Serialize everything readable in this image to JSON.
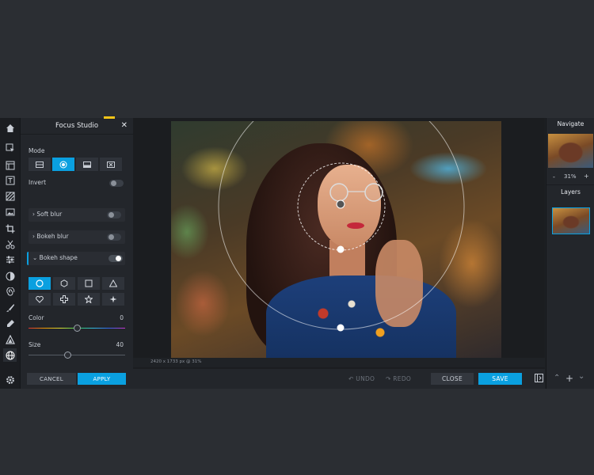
{
  "panel": {
    "title": "Focus Studio",
    "close_glyph": "✕",
    "mode_label": "Mode",
    "invert_label": "Invert",
    "soft_blur_label": "Soft blur",
    "bokeh_blur_label": "Bokeh blur",
    "bokeh_shape_label": "Bokeh shape",
    "color_label": "Color",
    "color_value": "0",
    "size_label": "Size",
    "size_value": "40",
    "cancel_label": "CANCEL",
    "apply_label": "APPLY",
    "toggles": {
      "invert": false,
      "soft_blur": false,
      "bokeh_blur": false,
      "bokeh_shape": true
    },
    "color_slider_fraction": 0.5,
    "size_slider_fraction": 0.4,
    "shapes": [
      "circle",
      "hexagon",
      "square",
      "triangle",
      "heart",
      "cross",
      "star",
      "sparkle"
    ],
    "selected_shape": "circle",
    "modes": [
      "linear-mode",
      "circle-mode",
      "bottom-mode",
      "none-mode"
    ],
    "selected_mode": "circle-mode"
  },
  "canvas": {
    "status_text": "2420 x 1733 px @ 31%"
  },
  "bottom_bar": {
    "undo_label": "UNDO",
    "redo_label": "REDO",
    "close_label": "CLOSE",
    "save_label": "SAVE"
  },
  "right_panel": {
    "navigate_label": "Navigate",
    "zoom_minus": "-",
    "zoom_value": "31%",
    "zoom_plus": "+",
    "layers_label": "Layers"
  },
  "colors": {
    "accent": "#0aa0e0",
    "highlight": "#f5c518",
    "panel": "#23262b",
    "background": "#2b2e33"
  },
  "rail_tools": [
    "home-icon",
    "arrange-icon",
    "layout-icon",
    "text-icon",
    "texture-icon",
    "image-icon",
    "crop-icon",
    "cutout-icon",
    "adjust-icon",
    "filter-icon",
    "swirl-icon",
    "brush-icon",
    "draw-icon",
    "shape-icon",
    "globe-icon",
    "settings-icon"
  ]
}
